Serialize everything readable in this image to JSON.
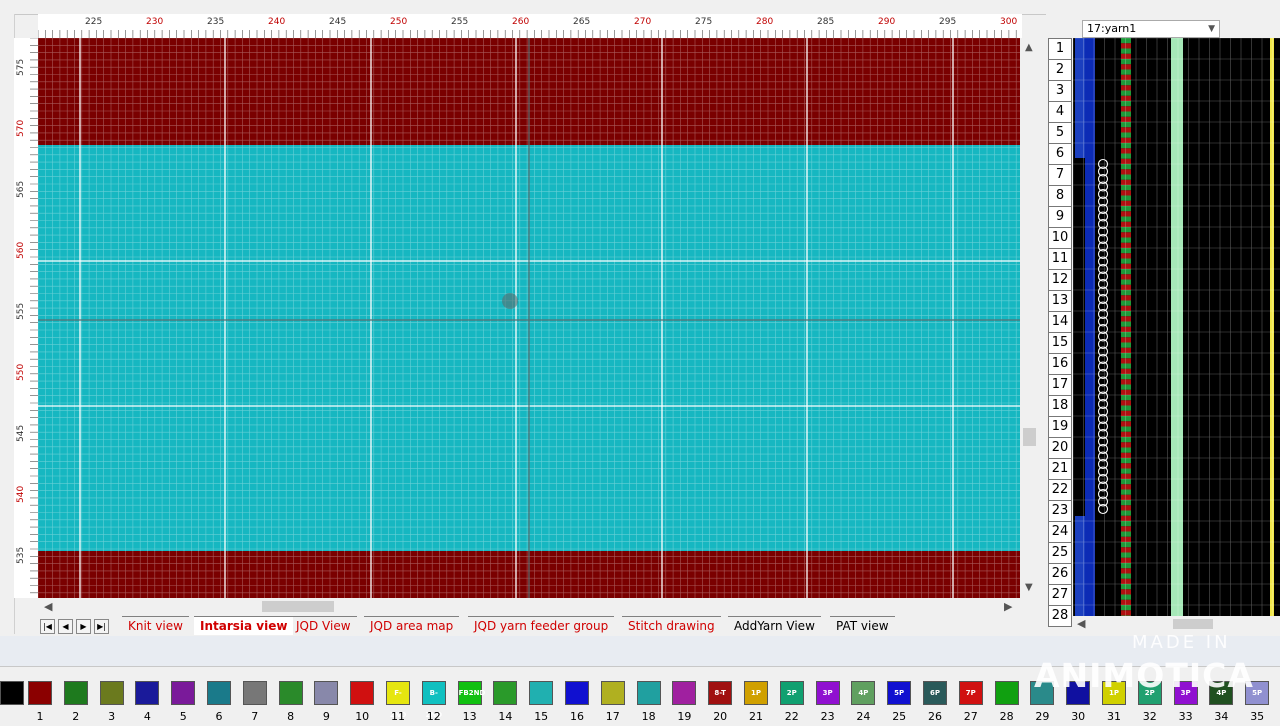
{
  "colors": {
    "dark_red": "#7a0000",
    "cyan": "#16b7c1",
    "selected_tab": "#ffffff",
    "tab_text": "#d00000"
  },
  "ruler": {
    "top_labels": [
      "225",
      "230",
      "235",
      "240",
      "245",
      "250",
      "255",
      "260",
      "265",
      "270",
      "275",
      "280",
      "285",
      "290",
      "295",
      "300"
    ],
    "left_labels": [
      "575",
      "570",
      "565",
      "560",
      "555",
      "550",
      "545",
      "540",
      "535"
    ]
  },
  "tabs": [
    {
      "label": "Knit view"
    },
    {
      "label": "Intarsia view"
    },
    {
      "label": "JQD View"
    },
    {
      "label": "JQD area map"
    },
    {
      "label": "JQD yarn feeder group"
    },
    {
      "label": "Stitch drawing"
    },
    {
      "label": "AddYarn View"
    },
    {
      "label": "PAT view"
    }
  ],
  "yarn_panel": {
    "selector_value": "17:yarn1",
    "rows": [
      "1",
      "2",
      "3",
      "4",
      "5",
      "6",
      "7",
      "8",
      "9",
      "10",
      "11",
      "12",
      "13",
      "14",
      "15",
      "16",
      "17",
      "18",
      "19",
      "20",
      "21",
      "22",
      "23",
      "24",
      "25",
      "26",
      "27",
      "28"
    ]
  },
  "palette": {
    "numbers": [
      "1",
      "2",
      "3",
      "4",
      "5",
      "6",
      "7",
      "8",
      "9",
      "10",
      "11",
      "12",
      "13",
      "14",
      "15",
      "16",
      "17",
      "18",
      "19",
      "20",
      "21",
      "22",
      "23",
      "24",
      "25",
      "26",
      "27",
      "28",
      "29",
      "30",
      "31",
      "32",
      "33",
      "34",
      "35"
    ],
    "icon_labels": {
      "11": "F-2ND",
      "12": "B-2ND",
      "13": "FB2ND",
      "20": "8-T",
      "21": "1P",
      "22": "2P",
      "23": "3P",
      "24": "4P",
      "25": "5P",
      "26": "6P",
      "27": "7P",
      "31": "1P",
      "32": "2P",
      "33": "3P",
      "34": "4P",
      "35": "5P"
    }
  },
  "watermark": {
    "line1": "MADE IN",
    "line2": "ANIMOTICA"
  }
}
